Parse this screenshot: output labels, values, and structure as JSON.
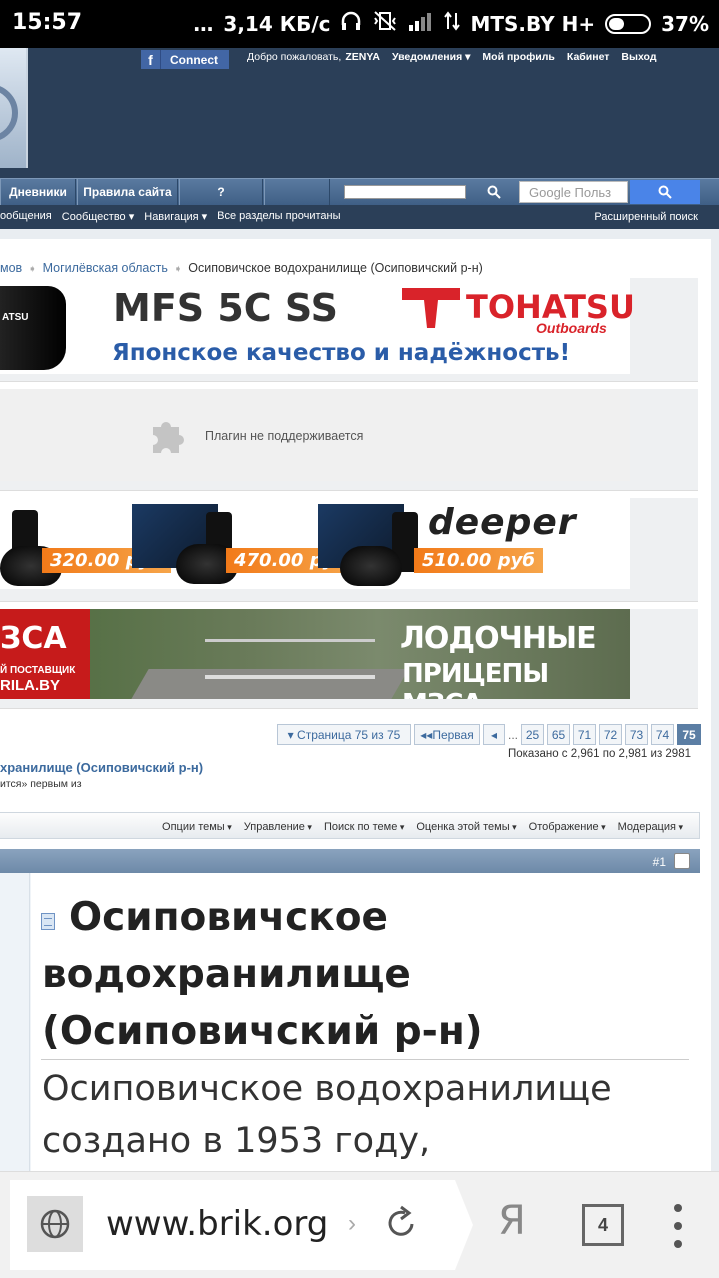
{
  "status_bar": {
    "time": "15:57",
    "dots": "…",
    "speed": "3,14 КБ/с",
    "carrier": "MTS.BY H+",
    "battery": "37%"
  },
  "header": {
    "fb_connect": "Connect",
    "greeting": "Добро пожаловать,",
    "username": "ZENYA",
    "notifications": "Уведомления ▾",
    "profile": "Мой профиль",
    "cabinet": "Кабинет",
    "logout": "Выход"
  },
  "navbar": {
    "tabs": [
      "Дневники",
      "Правила сайта",
      "?"
    ],
    "google_placeholder": "Google Польз"
  },
  "subnav": {
    "items": [
      "ообщения",
      "Сообщество ▾",
      "Навигация ▾",
      "Все разделы прочитаны"
    ],
    "advanced_search": "Расширенный поиск"
  },
  "breadcrumb": {
    "items": [
      "мов",
      "Могилёвская область"
    ],
    "current": "Осиповичское водохранилище (Осиповичский р-н)"
  },
  "banners": {
    "tohatsu": {
      "motor_text": "ATSU",
      "model": "MFS 5C SS",
      "brand": "TOHATSU",
      "brand_sub": "Outboards",
      "slogan": "Японское качество и надёжность!"
    },
    "plugin_message": "Плагин не поддерживается",
    "deeper": {
      "logo": "deeper",
      "prices": [
        "320.00 руб",
        "470.00 руб",
        "510.00 руб"
      ]
    },
    "trailer": {
      "brand": "ЗСА",
      "supplier": "Й ПОСТАВЩИК",
      "site": "RILA.BY",
      "headline1": "ЛОДОЧНЫЕ",
      "headline2": "ПРИЦЕПЫ МЗСА"
    }
  },
  "pagination": {
    "page_label": "▾ Страница 75 из 75",
    "first": "◂◂Первая",
    "prev": "◂",
    "ellipsis": "...",
    "pages": [
      "25",
      "65",
      "71",
      "72",
      "73",
      "74"
    ],
    "current": "75",
    "shown": "Показано с 2,961 по 2,981 из 2981"
  },
  "thread": {
    "title_fragment": "хранилище (Осиповичский р-н)",
    "sub_fragment": "ится» первым из"
  },
  "thread_tools": [
    "Опции темы",
    "Управление",
    "Поиск по теме",
    "Оценка этой темы",
    "Отображение",
    "Модерация"
  ],
  "post": {
    "number": "#1",
    "title": "Осиповичское водохранилище (Осиповичский р-н)",
    "text": "Осиповичское водохранилище создано в 1953 году,"
  },
  "browser": {
    "url": "www.brik.org",
    "url_chevron": "›",
    "ya": "Я",
    "tabs_count": "4"
  }
}
